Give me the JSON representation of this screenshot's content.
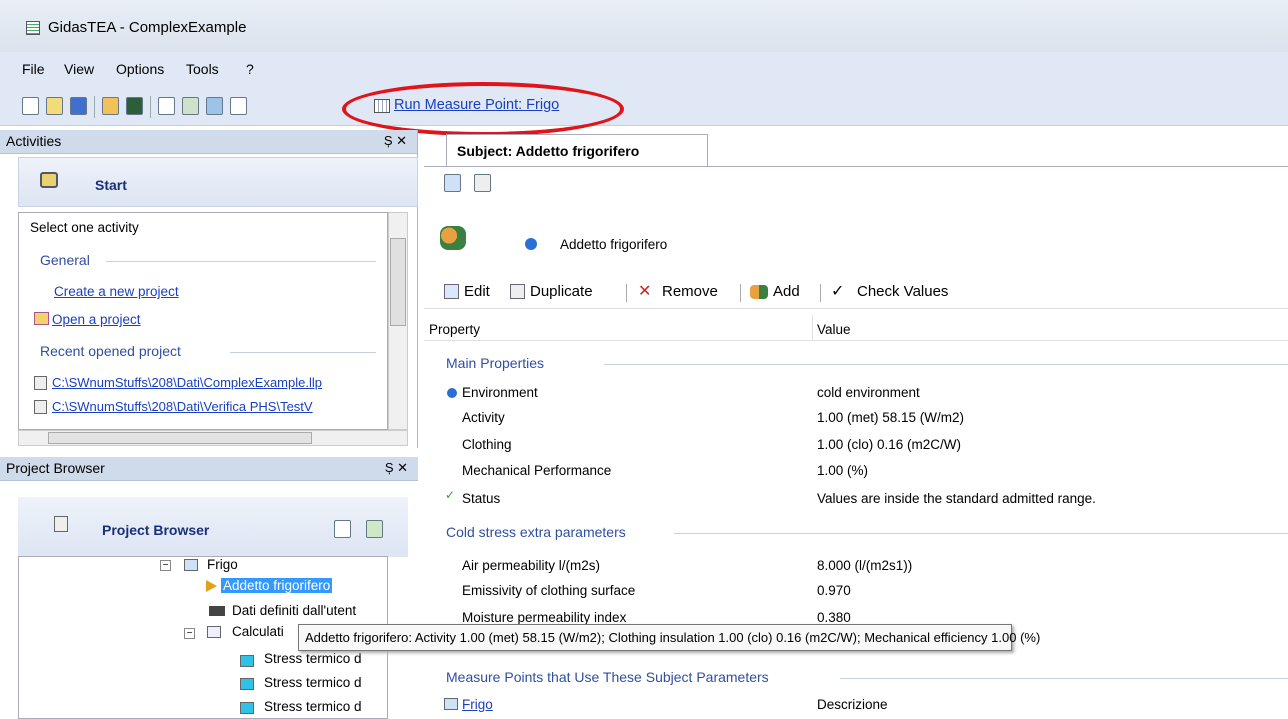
{
  "window": {
    "title": "GidasTEA - ComplexExample"
  },
  "menu": [
    {
      "label": "File"
    },
    {
      "label": "View"
    },
    {
      "label": "Options"
    },
    {
      "label": "Tools"
    },
    {
      "label": "?"
    }
  ],
  "toolbar": {
    "run_link": "Run Measure Point: Frigo"
  },
  "activities": {
    "header": "Activities",
    "pin": "Ș ✕",
    "start": "Start",
    "select_label": "Select one activity",
    "general": "General",
    "create": "Create a new project",
    "open": "Open a project",
    "recent": "Recent opened project",
    "recent_items": [
      "C:\\SWnumStuffs\\208\\Dati\\ComplexExample.llp",
      "C:\\SWnumStuffs\\208\\Dati\\Verifica PHS\\TestV"
    ]
  },
  "project_browser": {
    "header": "Project Browser",
    "title": "Project Browser",
    "tree": [
      "Frigo",
      "Addetto frigorifero",
      "Dati definiti dall'utent",
      "Calculati",
      "Stress termico d",
      "Stress termico d",
      "Stress termico d"
    ]
  },
  "subject": {
    "tab": "Subject: Addetto frigorifero",
    "name": "Addetto frigorifero",
    "actions": [
      "Edit",
      "Duplicate",
      "Remove",
      "Add",
      "Check Values"
    ],
    "col_property": "Property",
    "col_value": "Value",
    "sections": [
      {
        "title": "Main Properties"
      },
      {
        "title": "Cold stress extra parameters"
      },
      {
        "title": "Measure Points that Use These Subject Parameters"
      }
    ],
    "rows": [
      {
        "p": "Environment",
        "v": "cold environment"
      },
      {
        "p": "Activity",
        "v": "1.00 (met) 58.15 (W/m2)"
      },
      {
        "p": "Clothing",
        "v": "1.00 (clo) 0.16 (m2C/W)"
      },
      {
        "p": "Mechanical Performance",
        "v": "1.00 (%)"
      },
      {
        "p": "Status",
        "v": "Values are inside the standard admitted range."
      },
      {
        "p": "Air permeability  l/(m2s)",
        "v": "8.000  (l/(m2s1))"
      },
      {
        "p": "Emissivity of clothing surface",
        "v": "0.970"
      },
      {
        "p": "Moisture permeability index",
        "v": "0.380"
      },
      {
        "p": "Frigo",
        "v": "Descrizione"
      }
    ]
  },
  "tooltip": "Addetto frigorifero: Activity 1.00 (met) 58.15 (W/m2); Clothing insulation 1.00 (clo) 0.16 (m2C/W); Mechanical efficiency 1.00 (%)"
}
